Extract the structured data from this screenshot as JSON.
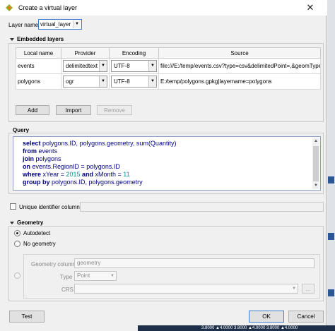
{
  "window": {
    "title": "Create a virtual layer",
    "close_glyph": "✕"
  },
  "layer_name": {
    "label": "Layer name",
    "value": "virtual_layer"
  },
  "embedded": {
    "title": "Embedded layers",
    "columns": [
      "Local name",
      "Provider",
      "Encoding",
      "Source"
    ],
    "rows": [
      {
        "local_name": "events",
        "provider": "delimitedtext",
        "encoding": "UTF-8",
        "source": "file:///E:/temp/events.csv?type=csv&delimitedPoint=,&geomType..."
      },
      {
        "local_name": "polygons",
        "provider": "ogr",
        "encoding": "UTF-8",
        "source": "E:/temp/polygons.gpkg|layername=polygons"
      }
    ],
    "buttons": {
      "add": "Add",
      "import": "Import",
      "remove": "Remove"
    }
  },
  "query": {
    "title": "Query",
    "lines": [
      {
        "kw": "select",
        "rest": " polygons.ID, polygons.geometry, sum(Quantity)"
      },
      {
        "kw": "from",
        "rest": " events"
      },
      {
        "kw": "join",
        "rest": " polygons"
      },
      {
        "kw": "on",
        "rest": " events.RegionID = polygons.ID"
      },
      {
        "kw": "where",
        "rest1": " xYear = ",
        "num1": "2015",
        "kw2": " and",
        "rest2": " xMonth = ",
        "num2": "11"
      },
      {
        "kw": "group by",
        "rest": " polygons.ID, polygons.geometry"
      }
    ]
  },
  "unique_id": {
    "label": "Unique identifier column",
    "value": ""
  },
  "geometry": {
    "title": "Geometry",
    "autodetect": "Autodetect",
    "no_geometry": "No geometry",
    "column_label": "Geometry column",
    "column_value": "geometry",
    "type_label": "Type",
    "type_value": "Point",
    "crs_label": "CRS",
    "crs_button": "..."
  },
  "footer": {
    "test": "Test",
    "ok": "OK",
    "cancel": "Cancel"
  },
  "background": {
    "bottom_text": "3.8000 ▲4.0000    3.8000 ▲4.0000    3.8000 ▲4.0000"
  },
  "icons": {
    "title": "qgis-logo-icon",
    "close": "close-icon",
    "dropdown": "chevron-down-icon",
    "section": "triangle-down-icon"
  },
  "colors": {
    "window_bg": "#f0f0f0",
    "keyword": "#000080",
    "number": "#009090",
    "focus": "#3c7fd1"
  }
}
